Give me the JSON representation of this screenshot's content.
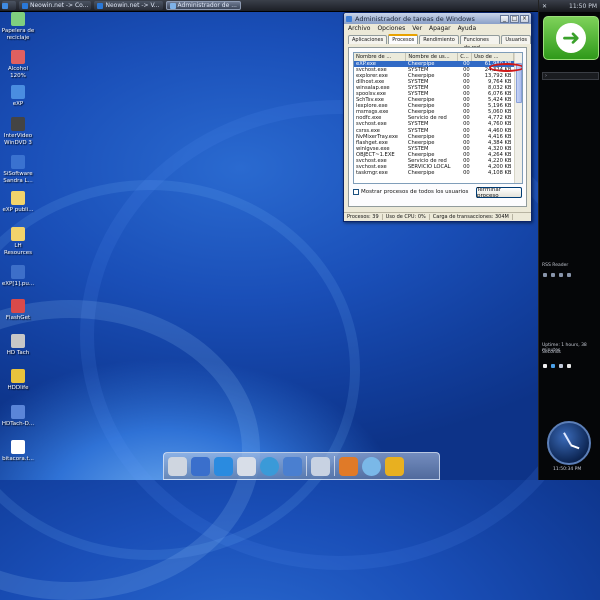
{
  "taskbar": {
    "buttons": [
      {
        "label": "Neowin.net -> Co...",
        "icon": "browser-icon"
      },
      {
        "label": "Neowin.net -> V...",
        "icon": "browser-icon"
      },
      {
        "label": "Administrador de ...",
        "icon": "taskmgr-icon"
      }
    ]
  },
  "desktop": {
    "icons": [
      {
        "label": "Papelera de reciclaje",
        "icon": "recycle-bin-icon",
        "color": "#7fcf7f"
      },
      {
        "label": "Alcohol 120%",
        "icon": "alcohol-icon",
        "color": "#e06060"
      },
      {
        "label": "eXP",
        "icon": "xp-icon",
        "color": "#4a8de0"
      },
      {
        "label": "InterVideo WinDVD 3",
        "icon": "windvd-icon",
        "color": "#444444"
      },
      {
        "label": "SiSoftware Sandra L...",
        "icon": "sandra-icon",
        "color": "#3a72d0"
      },
      {
        "label": "eXP publi...",
        "icon": "folder-icon",
        "color": "#f2d36b"
      },
      {
        "label": "LH Resources",
        "icon": "folder-icon",
        "color": "#f2d36b"
      },
      {
        "label": "eXP[1].pu...",
        "icon": "xp-file-icon",
        "color": "#3d6fc9"
      },
      {
        "label": "FlashGet",
        "icon": "flashget-icon",
        "color": "#d94a4a"
      },
      {
        "label": "HD Tach",
        "icon": "hdtach-icon",
        "color": "#c7c7c7"
      },
      {
        "label": "HDDlife",
        "icon": "hddlife-icon",
        "color": "#e8c33c"
      },
      {
        "label": "HDTach-D...",
        "icon": "hdtach-doc-icon",
        "color": "#5a85d8"
      },
      {
        "label": "bitacora.t...",
        "icon": "text-file-icon",
        "color": "#ffffff"
      }
    ]
  },
  "taskmanager": {
    "title": "Administrador de tareas de Windows",
    "menu": [
      "Archivo",
      "Opciones",
      "Ver",
      "Apagar",
      "Ayuda"
    ],
    "tabs": [
      "Aplicaciones",
      "Procesos",
      "Rendimiento",
      "Funciones de red",
      "Usuarios"
    ],
    "columns": [
      "Nombre de ...",
      "Nombre de us...",
      "C...",
      "Uso de ..."
    ],
    "rows": [
      [
        "eXP.exe",
        "Cheerpipe",
        "00",
        "61,980 KB"
      ],
      [
        "svchost.exe",
        "SYSTEM",
        "00",
        "24,324 KB"
      ],
      [
        "explorer.exe",
        "Cheerpipe",
        "00",
        "13,792 KB"
      ],
      [
        "dllhost.exe",
        "SYSTEM",
        "00",
        "9,764 KB"
      ],
      [
        "winsalap.exe",
        "SYSTEM",
        "00",
        "8,032 KB"
      ],
      [
        "spoolsv.exe",
        "SYSTEM",
        "00",
        "6,076 KB"
      ],
      [
        "SchTsv.exe",
        "Cheerpipe",
        "00",
        "5,424 KB"
      ],
      [
        "lexplore.exe",
        "Cheerpipe",
        "00",
        "5,196 KB"
      ],
      [
        "msmsgs.exe",
        "Cheerpipe",
        "00",
        "5,060 KB"
      ],
      [
        "nodfc.exe",
        "Servicio de red",
        "00",
        "4,772 KB"
      ],
      [
        "svchost.exe",
        "SYSTEM",
        "00",
        "4,760 KB"
      ],
      [
        "csrss.exe",
        "SYSTEM",
        "00",
        "4,460 KB"
      ],
      [
        "NvMixerTray.exe",
        "Cheerpipe",
        "00",
        "4,416 KB"
      ],
      [
        "flashget.exe",
        "Cheerpipe",
        "00",
        "4,384 KB"
      ],
      [
        "winlgvse.exe",
        "SYSTEM",
        "00",
        "4,320 KB"
      ],
      [
        "OBJECT~1.EXE",
        "Cheerpipe",
        "00",
        "4,264 KB"
      ],
      [
        "svchost.exe",
        "Servicio de red",
        "00",
        "4,220 KB"
      ],
      [
        "svchost.exe",
        "SERVICIO LOCAL",
        "00",
        "4,200 KB"
      ],
      [
        "taskmgr.exe",
        "Cheerpipe",
        "00",
        "4,108 KB"
      ]
    ],
    "show_all_label": "Mostrar procesos de todos los usuarios",
    "end_process_label": "Terminar proceso",
    "status": [
      "Procesos: 39",
      "Uso de CPU: 0%",
      "Carga de transacciones: 304M"
    ]
  },
  "sidebar": {
    "top_time": "11:50 PM",
    "rss_label": "RSS Reader",
    "uptime": "Uptime: 1 hours, 38 minutes",
    "uptime_sub": "Seconds",
    "clock_time": "11:50:34 PM"
  },
  "dock": {
    "icons": [
      "printer-icon",
      "computer-icon",
      "ie-browser-icon",
      "trash-icon",
      "media-player-icon",
      "display-icon",
      "user-icon",
      "firefox-icon",
      "itunes-icon",
      "messenger-icon"
    ]
  }
}
